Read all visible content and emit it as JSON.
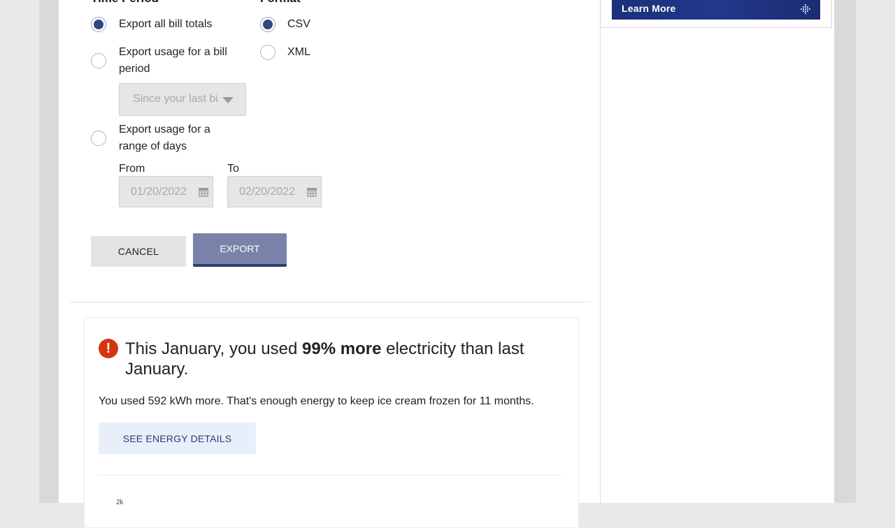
{
  "form": {
    "time_period_heading": "Time Period",
    "format_heading": "Format",
    "time_options": [
      {
        "label": "Export all bill totals",
        "checked": true
      },
      {
        "label": "Export usage for a bill period",
        "checked": false
      },
      {
        "label": "Export usage for a range of days",
        "checked": false
      }
    ],
    "format_options": [
      {
        "label": "CSV",
        "checked": true
      },
      {
        "label": "XML",
        "checked": false
      }
    ],
    "bill_period_select": {
      "value": "Since your last bi",
      "disabled": true
    },
    "range": {
      "from_label": "From",
      "to_label": "To",
      "from_value": "01/20/2022",
      "to_value": "02/20/2022"
    },
    "cancel_label": "CANCEL",
    "export_label": "EXPORT"
  },
  "insight": {
    "headline_pre": "This January, you used ",
    "headline_bold": "99% more",
    "headline_post": " electricity than last January.",
    "body": "You used 592 kWh more. That's enough energy to keep ice cream frozen for 11 months.",
    "button_label": "SEE ENERGY DETAILS",
    "alert_glyph": "!",
    "cropped_text": "2k"
  },
  "sidebar": {
    "ad_text": "Learn More"
  },
  "colors": {
    "accent": "#344680",
    "export_button": "#7983a9",
    "alert": "#d3360f",
    "ad_banner": "#22388c"
  },
  "icons": [
    "calendar-icon",
    "caret-down-icon",
    "alert-icon",
    "arrow-right-icon"
  ]
}
